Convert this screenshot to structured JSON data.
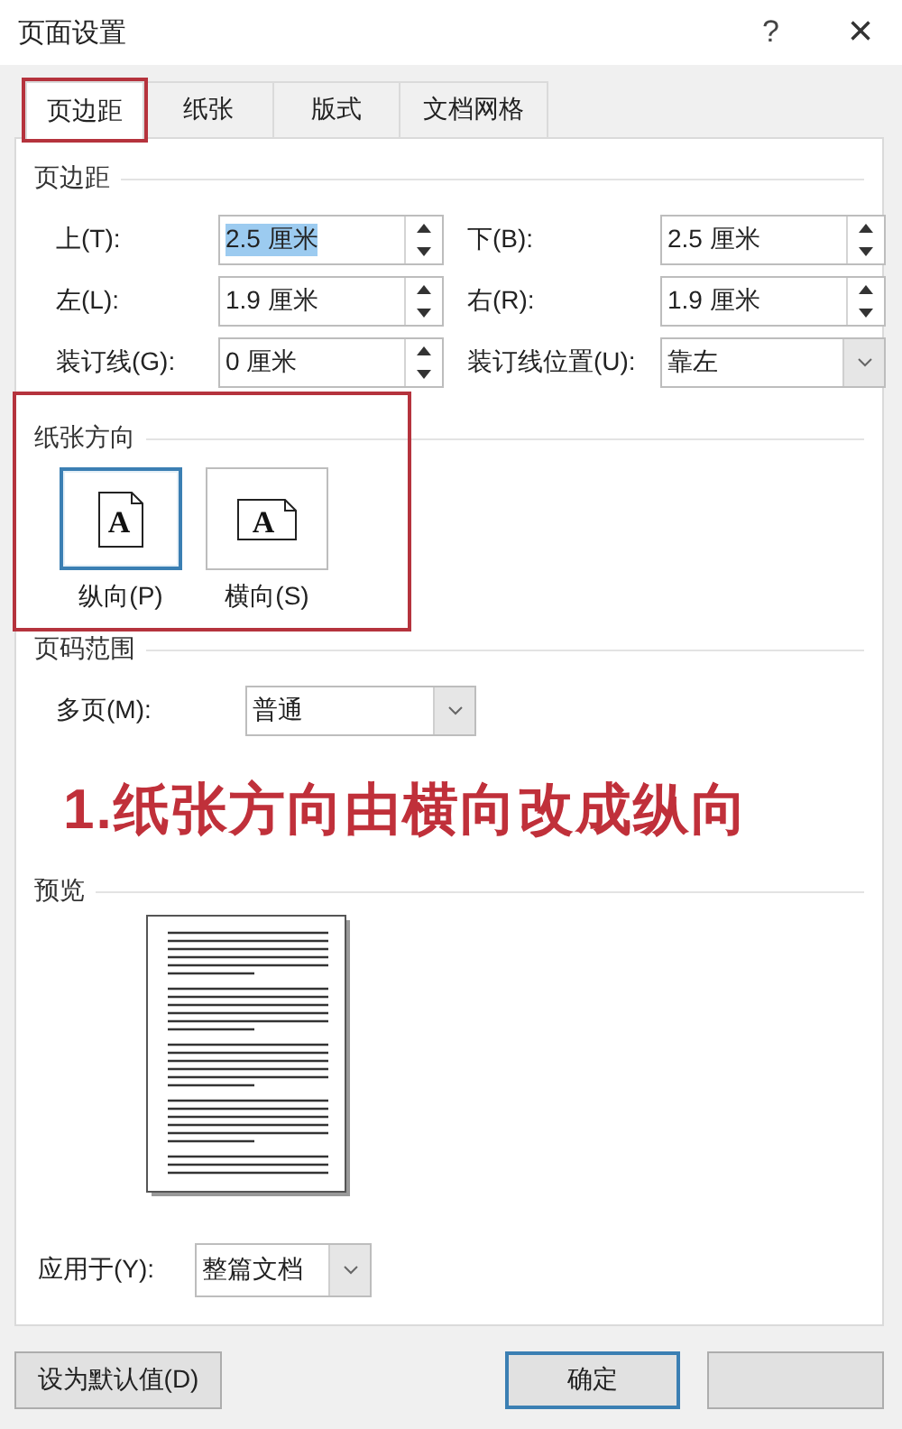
{
  "window": {
    "title": "页面设置",
    "help": "?",
    "close": "×"
  },
  "tabs": [
    {
      "label": "页边距",
      "selected": true,
      "highlighted": true
    },
    {
      "label": "纸张",
      "selected": false,
      "highlighted": false
    },
    {
      "label": "版式",
      "selected": false,
      "highlighted": false
    },
    {
      "label": "文档网格",
      "selected": false,
      "highlighted": false
    }
  ],
  "margins": {
    "heading": "页边距",
    "fields": [
      {
        "label": "上(T):",
        "value": "2.5 厘米",
        "kind": "spin",
        "text_selected": true
      },
      {
        "label": "下(B):",
        "value": "2.5 厘米",
        "kind": "spin",
        "text_selected": false
      },
      {
        "label": "左(L):",
        "value": "1.9 厘米",
        "kind": "spin",
        "text_selected": false
      },
      {
        "label": "右(R):",
        "value": "1.9 厘米",
        "kind": "spin",
        "text_selected": false
      },
      {
        "label": "装订线(G):",
        "value": "0 厘米",
        "kind": "spin",
        "text_selected": false
      },
      {
        "label": "装订线位置(U):",
        "value": "靠左",
        "kind": "combo",
        "text_selected": false
      }
    ]
  },
  "orientation": {
    "heading": "纸张方向",
    "highlighted": true,
    "options": [
      {
        "label": "纵向(P)",
        "kind": "portrait",
        "selected": true,
        "icon_letter": "A"
      },
      {
        "label": "横向(S)",
        "kind": "landscape",
        "selected": false,
        "icon_letter": "A"
      }
    ]
  },
  "pages": {
    "heading": "页码范围",
    "label": "多页(M):",
    "value": "普通"
  },
  "annotation": "1.纸张方向由横向改成纵向",
  "preview": {
    "heading": "预览",
    "apply_label": "应用于(Y):",
    "apply_value": "整篇文档"
  },
  "buttons": [
    {
      "label": "设为默认值(D)",
      "default": false
    },
    {
      "label": "确定",
      "default": true
    }
  ]
}
